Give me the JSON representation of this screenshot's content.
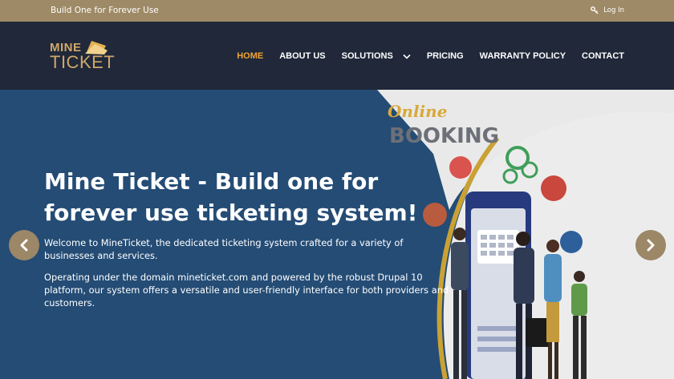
{
  "topbar": {
    "tagline": "Build One for Forever Use",
    "login_label": "Log In",
    "login_icon": "key-icon"
  },
  "logo": {
    "line1": "MINE",
    "line2": "TICKET"
  },
  "nav": {
    "items": [
      {
        "label": "HOME",
        "active": true
      },
      {
        "label": "ABOUT US"
      },
      {
        "label": "SOLUTIONS",
        "has_dropdown": true
      },
      {
        "label": "PRICING"
      },
      {
        "label": "WARRANTY POLICY"
      },
      {
        "label": "CONTACT"
      }
    ]
  },
  "hero": {
    "title": "Mine Ticket - Build one for forever use ticketing system!",
    "paragraph1": "Welcome to MineTicket, the dedicated ticketing system crafted for a variety of businesses and services.",
    "paragraph2": "Operating under the domain mineticket.com and powered by the robust Drupal 10 platform, our system offers a versatile and user-friendly interface for both providers and customers.",
    "illustration_text": {
      "script": "Online",
      "word": "BOOKING"
    }
  },
  "slider": {
    "prev_icon": "chevron-left-icon",
    "next_icon": "chevron-right-icon"
  },
  "colors": {
    "topbar": "#9e8a66",
    "header": "#20283a",
    "accent": "#f2a531",
    "hero_bg": "#244c75",
    "arrow_bg": "#9c8767"
  }
}
